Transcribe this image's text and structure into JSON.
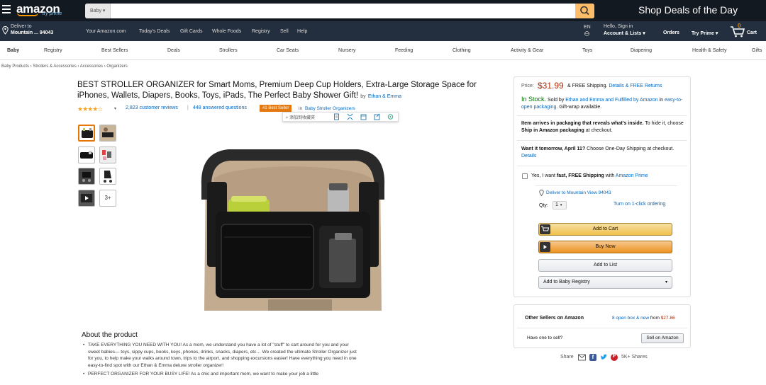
{
  "header": {
    "logo": "amazon",
    "logo_sub": "try prime",
    "search_category": "Baby ▾",
    "search_placeholder": "",
    "deal_banner": "Shop Deals of the Day"
  },
  "nav": {
    "deliver_label": "Deliver to",
    "deliver_location": "Mountain ... 94043",
    "links": [
      "Your Amazon.com",
      "Today's Deals",
      "Gift Cards",
      "Whole Foods",
      "Registry",
      "Sell",
      "Help"
    ],
    "lang": "EN",
    "account_top": "Hello, Sign in",
    "account_bottom": "Account & Lists ▾",
    "orders": "Orders",
    "prime": "Try Prime ▾",
    "cart_count": "0",
    "cart_label": "Cart"
  },
  "categories": [
    "Baby",
    "Registry",
    "Best Sellers",
    "Deals",
    "Strollers",
    "Car Seats",
    "Nursery",
    "Feeding",
    "Clothing",
    "Activity & Gear",
    "Toys",
    "Diapering",
    "Health & Safety",
    "Gifts"
  ],
  "breadcrumb": "Baby Products › Strollers & Accessories › Accessories › Organizers",
  "product": {
    "title": "BEST STROLLER ORGANIZER for Smart Moms, Premium Deep Cup Holders, Extra-Large Storage Space for iPhones, Wallets, Diapers, Books, Toys, iPads, The Perfect Baby Shower Gift!",
    "by_label": "by",
    "brand": "Ethan & Emma",
    "rating": 4.5,
    "stars": "★★★★☆",
    "reviews": "2,823 customer reviews",
    "separator": "|",
    "answered": "448 answered questions",
    "badge": "#1 Best Seller",
    "badge_in": "in",
    "badge_category": "Baby Stroller Organizers",
    "more_thumbs": "3+"
  },
  "toolbar": {
    "add_label": "+ 添加到收藏夹"
  },
  "about": {
    "heading": "About the product",
    "bullets": [
      "TAKE EVERYTHING YOU NEED WITH YOU! As a mom, we understand you have a lot of \"stuff\" to cart around for you and your sweet babies— toys, sippy cups, books, keys, phones, drinks, snacks, diapers, etc… We created the ultimate Stroller Organizer just for you, to help make your walks around town, trips to the airport, and shopping excursions easier! Have everything you need in one easy-to-find spot with our Ethan & Emma deluxe stroller organizer!",
      "PERFECT ORGANIZER FOR YOUR BUSY LIFE! As a chic and important mom, we want to make your job a little"
    ]
  },
  "buybox": {
    "price_label": "Price:",
    "price": "$31.99",
    "free_shipping": "& FREE Shipping.",
    "details_link": "Details & FREE Returns",
    "stock": "In Stock.",
    "sold_by": "Sold by",
    "seller": "Ethan and Emma",
    "fulfilled": "and Fulfilled by Amazon",
    "in_label": "in",
    "packaging": "easy-to-open packaging",
    "gift": ". Gift-wrap available.",
    "packaging_note_bold": "Item arrives in packaging that reveals what's inside.",
    "packaging_note": " To hide it, choose ",
    "packaging_note_bold2": "Ship in Amazon packaging",
    "packaging_note_end": " at checkout.",
    "want_it": "Want it tomorrow, April 11?",
    "one_day": " Choose One-Day Shipping",
    "one_day_end": " at checkout.",
    "details": "Details",
    "prime_check_pre": "Yes, I want ",
    "prime_check_bold": "fast, FREE Shipping",
    "prime_check_mid": " with ",
    "prime_check_link": "Amazon Prime",
    "deliver_to": "Deliver to Mountain View 94043",
    "qty_label": "Qty:",
    "qty_value": "1",
    "one_click": "Turn on 1-click ordering",
    "add_to_cart": "Add to Cart",
    "buy_now": "Buy Now",
    "add_to_list": "Add to List",
    "add_to_registry": "Add to Baby Registry"
  },
  "other_sellers": {
    "heading": "Other Sellers on Amazon",
    "offers_link": "8 open box & new",
    "offers_from": "from",
    "offers_price": "$27.86",
    "have_one": "Have one to sell?",
    "sell_btn": "Sell on Amazon"
  },
  "share": {
    "label": "Share",
    "count": "5K+ Shares"
  },
  "colors": {
    "topbar": "#131921",
    "navbar": "#232f3e",
    "accent": "#febd69",
    "price": "#b12704",
    "link": "#0066c0",
    "instock": "#007600",
    "badge": "#e47911"
  }
}
